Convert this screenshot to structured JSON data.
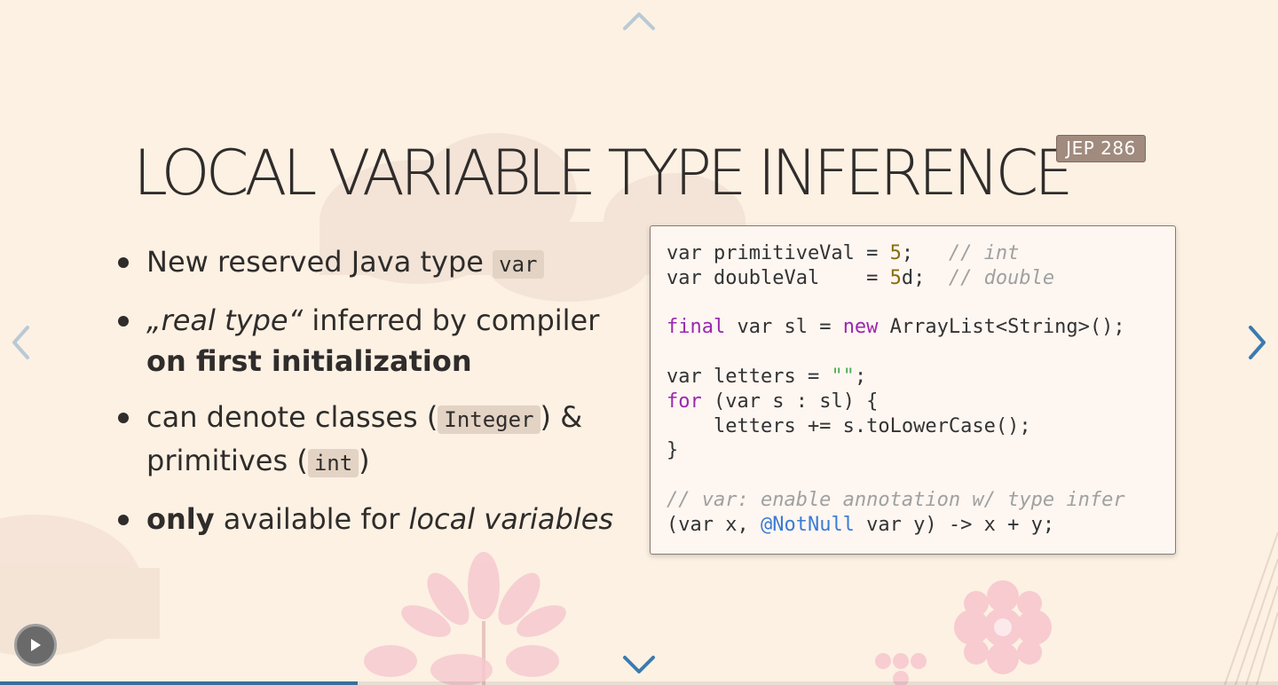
{
  "slide": {
    "title": "LOCAL VARIABLE TYPE INFERENCE",
    "badge": "JEP 286"
  },
  "bullets": {
    "b1_text": "New reserved Java type ",
    "b1_code": "var",
    "b2_italic": "„real type“",
    "b2_text": " inferred by compiler ",
    "b2_bold": "on first initialization",
    "b3_text1": "can denote classes (",
    "b3_code1": "Integer",
    "b3_text2": ") & primitives (",
    "b3_code2": "int",
    "b3_text3": ")",
    "b4_bold": "only",
    "b4_text": " available for ",
    "b4_italic": "local variables"
  },
  "code": {
    "l1_a": "var primitiveVal = ",
    "l1_num": "5",
    "l1_b": ";   ",
    "l1_cm": "// int",
    "l2_a": "var doubleVal    = ",
    "l2_num": "5",
    "l2_b": "d;  ",
    "l2_cm": "// double",
    "l3_kw1": "final",
    "l3_a": " var sl = ",
    "l3_kw2": "new",
    "l3_b": " ArrayList<String>();",
    "l4_a": "var letters = ",
    "l4_str": "\"\"",
    "l4_b": ";",
    "l5_kw": "for",
    "l5_a": " (var s : sl) {",
    "l6": "    letters += s.toLowerCase();",
    "l7": "}",
    "l8_cm": "// var: enable annotation w/ type infer",
    "l9_a": "(var x, ",
    "l9_ann": "@NotNull",
    "l9_b": " var y) -> x + y;"
  },
  "navigation": {
    "up_icon": "chevron-up-icon",
    "down_icon": "chevron-down-icon",
    "left_icon": "chevron-left-icon",
    "right_icon": "chevron-right-icon",
    "play_icon": "play-icon"
  },
  "progress": {
    "fraction": 0.28
  },
  "colors": {
    "background": "#fcf1e3",
    "accent": "#3a7bb0",
    "badge": "#a08b7e"
  }
}
